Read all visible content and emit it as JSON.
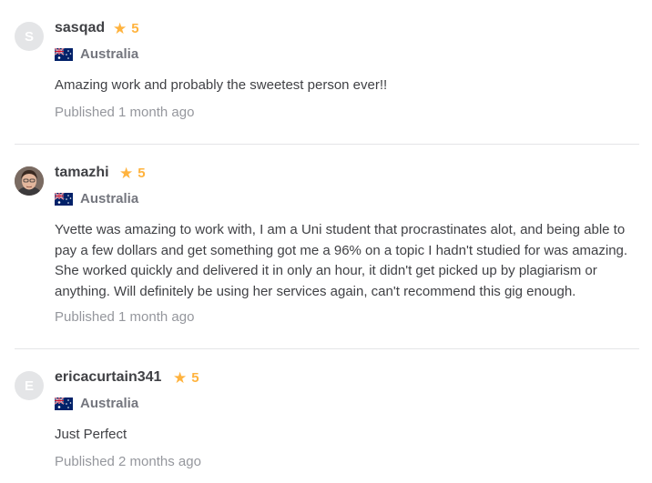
{
  "reviews": [
    {
      "avatar_initial": "S",
      "avatar_kind": "initial",
      "username": "sasqad",
      "rating": "5",
      "country": "Australia",
      "flag_icon": "australia-flag-icon",
      "text": "Amazing work and probably the sweetest person ever!!",
      "published": "Published 1 month ago"
    },
    {
      "avatar_initial": "",
      "avatar_kind": "photo",
      "username": "tamazhi",
      "rating": "5",
      "country": "Australia",
      "flag_icon": "australia-flag-icon",
      "text": "Yvette was amazing to work with, I am a Uni student that procrastinates alot, and being able to pay a few dollars and get something got me a 96% on a topic I hadn't studied for was amazing. She worked quickly and delivered it in only an hour, it didn't get picked up by plagiarism or anything. Will definitely be using her services again, can't recommend this gig enough.",
      "published": "Published 1 month ago"
    },
    {
      "avatar_initial": "E",
      "avatar_kind": "initial",
      "username": "ericacurtain341",
      "rating": "5",
      "country": "Australia",
      "flag_icon": "australia-flag-icon",
      "text": "Just Perfect",
      "published": "Published 2 months ago"
    }
  ],
  "colors": {
    "star": "#ffb33e",
    "text": "#404145",
    "muted": "#74767e",
    "published": "#95979d",
    "divider": "#e4e5e7"
  }
}
